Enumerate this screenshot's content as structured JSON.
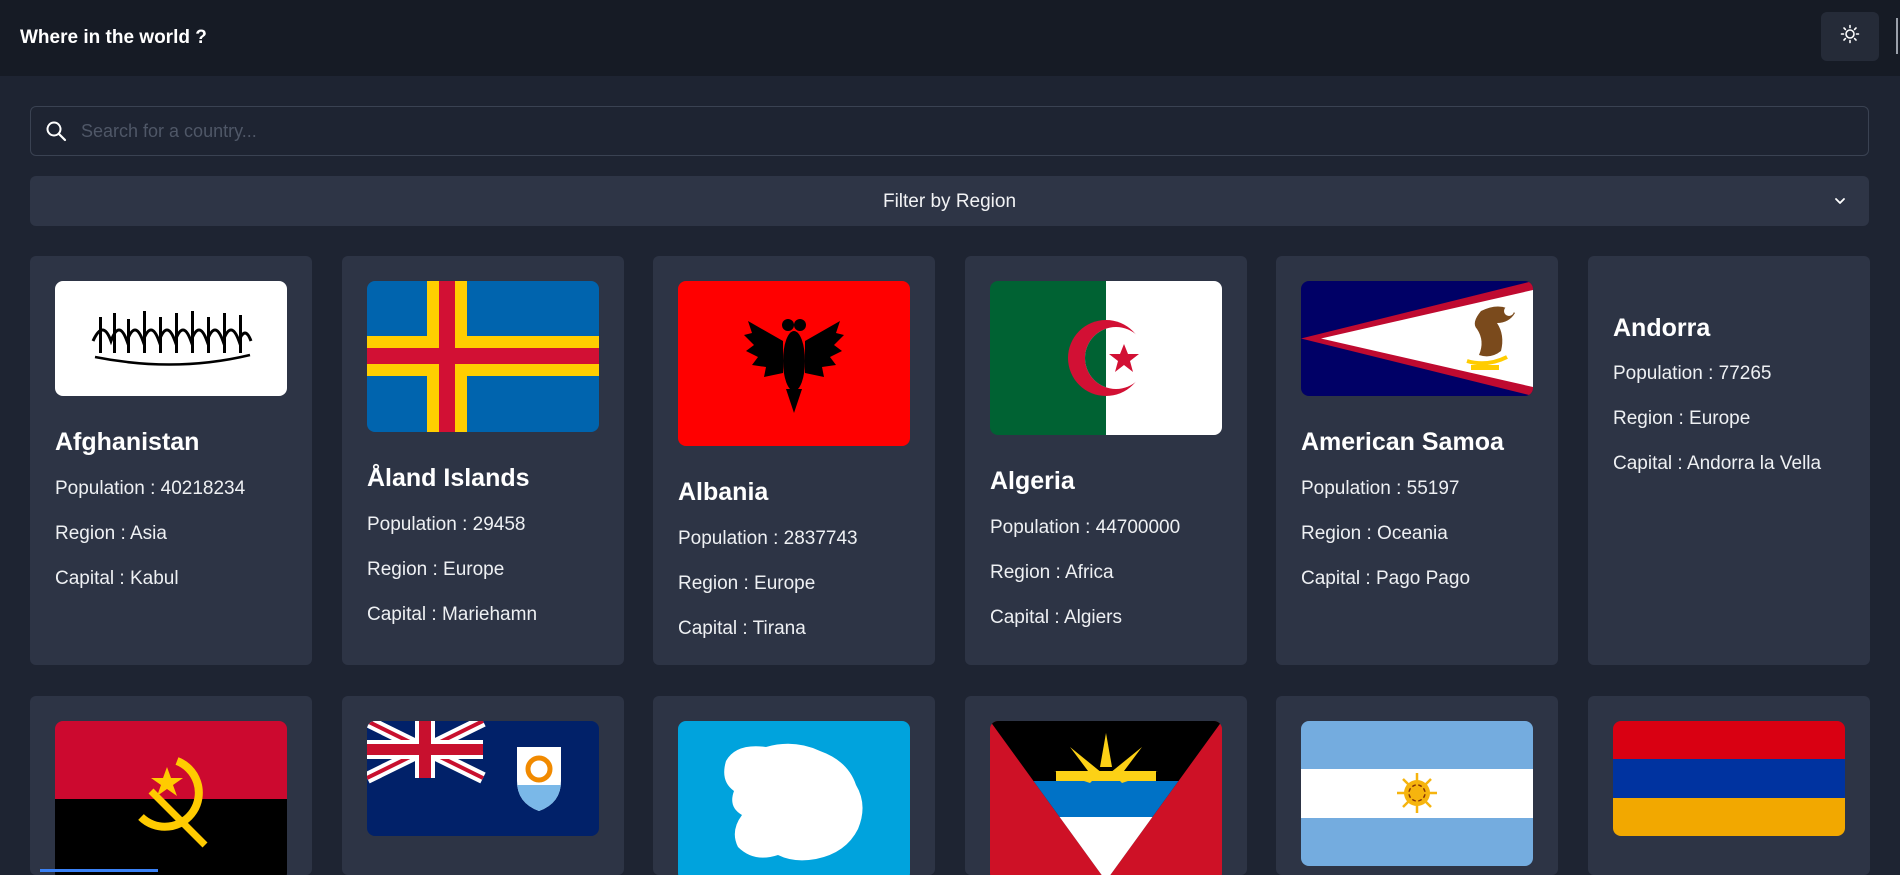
{
  "header": {
    "title": "Where in the world ?",
    "theme_toggle_icon": "sun-icon"
  },
  "search": {
    "placeholder": "Search for a country...",
    "value": "",
    "icon": "search-icon"
  },
  "filter": {
    "label": "Filter by Region",
    "icon": "chevron-down-icon"
  },
  "labels": {
    "population": "Population : ",
    "region": "Region : ",
    "capital": "Capital : "
  },
  "countries": [
    {
      "name": "Afghanistan",
      "population": "40218234",
      "region": "Asia",
      "capital": "Kabul"
    },
    {
      "name": "Åland Islands",
      "population": "29458",
      "region": "Europe",
      "capital": "Mariehamn"
    },
    {
      "name": "Albania",
      "population": "2837743",
      "region": "Europe",
      "capital": "Tirana"
    },
    {
      "name": "Algeria",
      "population": "44700000",
      "region": "Africa",
      "capital": "Algiers"
    },
    {
      "name": "American Samoa",
      "population": "55197",
      "region": "Oceania",
      "capital": "Pago Pago"
    },
    {
      "name": "Andorra",
      "population": "77265",
      "region": "Europe",
      "capital": "Andorra la Vella"
    }
  ],
  "second_row_flags": [
    "Angola",
    "Anguilla",
    "Antarctica",
    "Antigua and Barbuda",
    "Argentina",
    "Armenia"
  ],
  "colors": {
    "background": "#1e2432",
    "header": "#161b25",
    "card": "#2d3445",
    "accent": "#3b82f6"
  }
}
